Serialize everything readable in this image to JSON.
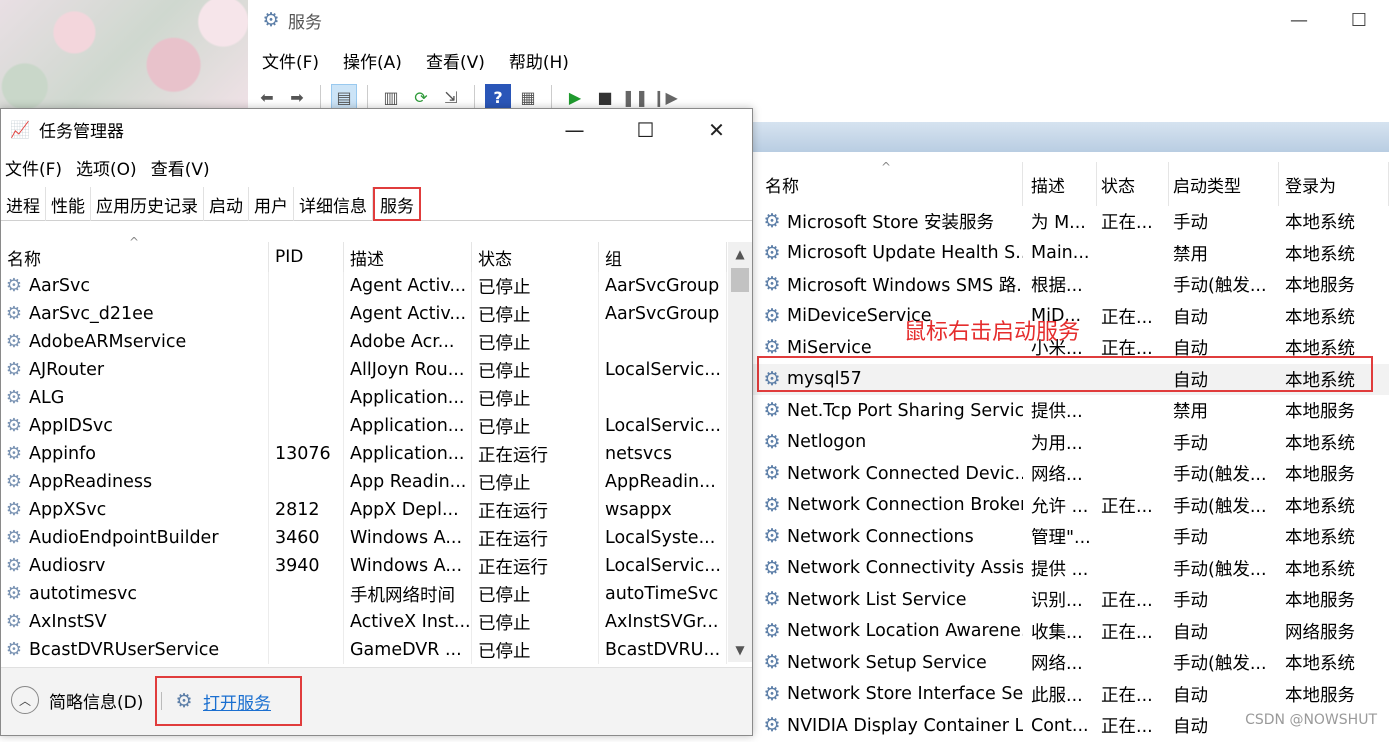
{
  "services_window": {
    "title": "服务",
    "menu": [
      "文件(F)",
      "操作(A)",
      "查看(V)",
      "帮助(H)"
    ],
    "columns": [
      "名称",
      "描述",
      "状态",
      "启动类型",
      "登录为"
    ],
    "rows": [
      {
        "name": "Microsoft Store 安装服务",
        "desc": "为 M...",
        "status": "正在...",
        "type": "手动",
        "logon": "本地系统"
      },
      {
        "name": "Microsoft Update Health S...",
        "desc": "Main...",
        "status": "",
        "type": "禁用",
        "logon": "本地系统"
      },
      {
        "name": "Microsoft Windows SMS 路...",
        "desc": "根据...",
        "status": "",
        "type": "手动(触发...",
        "logon": "本地服务"
      },
      {
        "name": "MiDeviceService",
        "desc": "MiD...",
        "status": "正在...",
        "type": "自动",
        "logon": "本地系统"
      },
      {
        "name": "MiService",
        "desc": "小米...",
        "status": "正在...",
        "type": "自动",
        "logon": "本地系统"
      },
      {
        "name": "mysql57",
        "desc": "",
        "status": "",
        "type": "自动",
        "logon": "本地系统"
      },
      {
        "name": "Net.Tcp Port Sharing Service",
        "desc": "提供...",
        "status": "",
        "type": "禁用",
        "logon": "本地服务"
      },
      {
        "name": "Netlogon",
        "desc": "为用...",
        "status": "",
        "type": "手动",
        "logon": "本地系统"
      },
      {
        "name": "Network Connected Devic...",
        "desc": "网络...",
        "status": "",
        "type": "手动(触发...",
        "logon": "本地服务"
      },
      {
        "name": "Network Connection Broker",
        "desc": "允许 ...",
        "status": "正在...",
        "type": "手动(触发...",
        "logon": "本地系统"
      },
      {
        "name": "Network Connections",
        "desc": "管理\"...",
        "status": "",
        "type": "手动",
        "logon": "本地系统"
      },
      {
        "name": "Network Connectivity Assis...",
        "desc": "提供 ...",
        "status": "",
        "type": "手动(触发...",
        "logon": "本地系统"
      },
      {
        "name": "Network List Service",
        "desc": "识别...",
        "status": "正在...",
        "type": "手动",
        "logon": "本地服务"
      },
      {
        "name": "Network Location Awarene...",
        "desc": "收集...",
        "status": "正在...",
        "type": "自动",
        "logon": "网络服务"
      },
      {
        "name": "Network Setup Service",
        "desc": "网络...",
        "status": "",
        "type": "手动(触发...",
        "logon": "本地系统"
      },
      {
        "name": "Network Store Interface Se...",
        "desc": "此服...",
        "status": "正在...",
        "type": "自动",
        "logon": "本地服务"
      },
      {
        "name": "NVIDIA Display Container LS",
        "desc": "Cont...",
        "status": "正在...",
        "type": "自动",
        "logon": ""
      }
    ],
    "annotation": "鼠标右击启动服务",
    "watermark": "CSDN @NOWSHUT"
  },
  "task_manager": {
    "title": "任务管理器",
    "menu": [
      "文件(F)",
      "选项(O)",
      "查看(V)"
    ],
    "tabs": [
      "进程",
      "性能",
      "应用历史记录",
      "启动",
      "用户",
      "详细信息",
      "服务"
    ],
    "active_tab": "服务",
    "columns": [
      "名称",
      "PID",
      "描述",
      "状态",
      "组"
    ],
    "rows": [
      {
        "name": "AarSvc",
        "pid": "",
        "desc": "Agent Activ...",
        "status": "已停止",
        "group": "AarSvcGroup"
      },
      {
        "name": "AarSvc_d21ee",
        "pid": "",
        "desc": "Agent Activ...",
        "status": "已停止",
        "group": "AarSvcGroup"
      },
      {
        "name": "AdobeARMservice",
        "pid": "",
        "desc": "Adobe Acr...",
        "status": "已停止",
        "group": ""
      },
      {
        "name": "AJRouter",
        "pid": "",
        "desc": "AllJoyn Rou...",
        "status": "已停止",
        "group": "LocalServic..."
      },
      {
        "name": "ALG",
        "pid": "",
        "desc": "Application...",
        "status": "已停止",
        "group": ""
      },
      {
        "name": "AppIDSvc",
        "pid": "",
        "desc": "Application...",
        "status": "已停止",
        "group": "LocalServic..."
      },
      {
        "name": "Appinfo",
        "pid": "13076",
        "desc": "Application...",
        "status": "正在运行",
        "group": "netsvcs"
      },
      {
        "name": "AppReadiness",
        "pid": "",
        "desc": "App Readin...",
        "status": "已停止",
        "group": "AppReadin..."
      },
      {
        "name": "AppXSvc",
        "pid": "2812",
        "desc": "AppX Depl...",
        "status": "正在运行",
        "group": "wsappx"
      },
      {
        "name": "AudioEndpointBuilder",
        "pid": "3460",
        "desc": "Windows A...",
        "status": "正在运行",
        "group": "LocalSyste..."
      },
      {
        "name": "Audiosrv",
        "pid": "3940",
        "desc": "Windows A...",
        "status": "正在运行",
        "group": "LocalServic..."
      },
      {
        "name": "autotimesvc",
        "pid": "",
        "desc": "手机网络时间",
        "status": "已停止",
        "group": "autoTimeSvc"
      },
      {
        "name": "AxInstSV",
        "pid": "",
        "desc": "ActiveX Inst...",
        "status": "已停止",
        "group": "AxInstSVGr..."
      },
      {
        "name": "BcastDVRUserService",
        "pid": "",
        "desc": "GameDVR ...",
        "status": "已停止",
        "group": "BcastDVRU..."
      }
    ],
    "footer": {
      "fewer_details": "简略信息(D)",
      "open_services": "打开服务"
    }
  },
  "icons": {
    "service": "gear-icon",
    "minimize": "minimize-icon",
    "maximize": "maximize-icon",
    "close": "close-icon"
  },
  "colors": {
    "highlight": "#e03c3c",
    "link": "#1a6fd0"
  }
}
